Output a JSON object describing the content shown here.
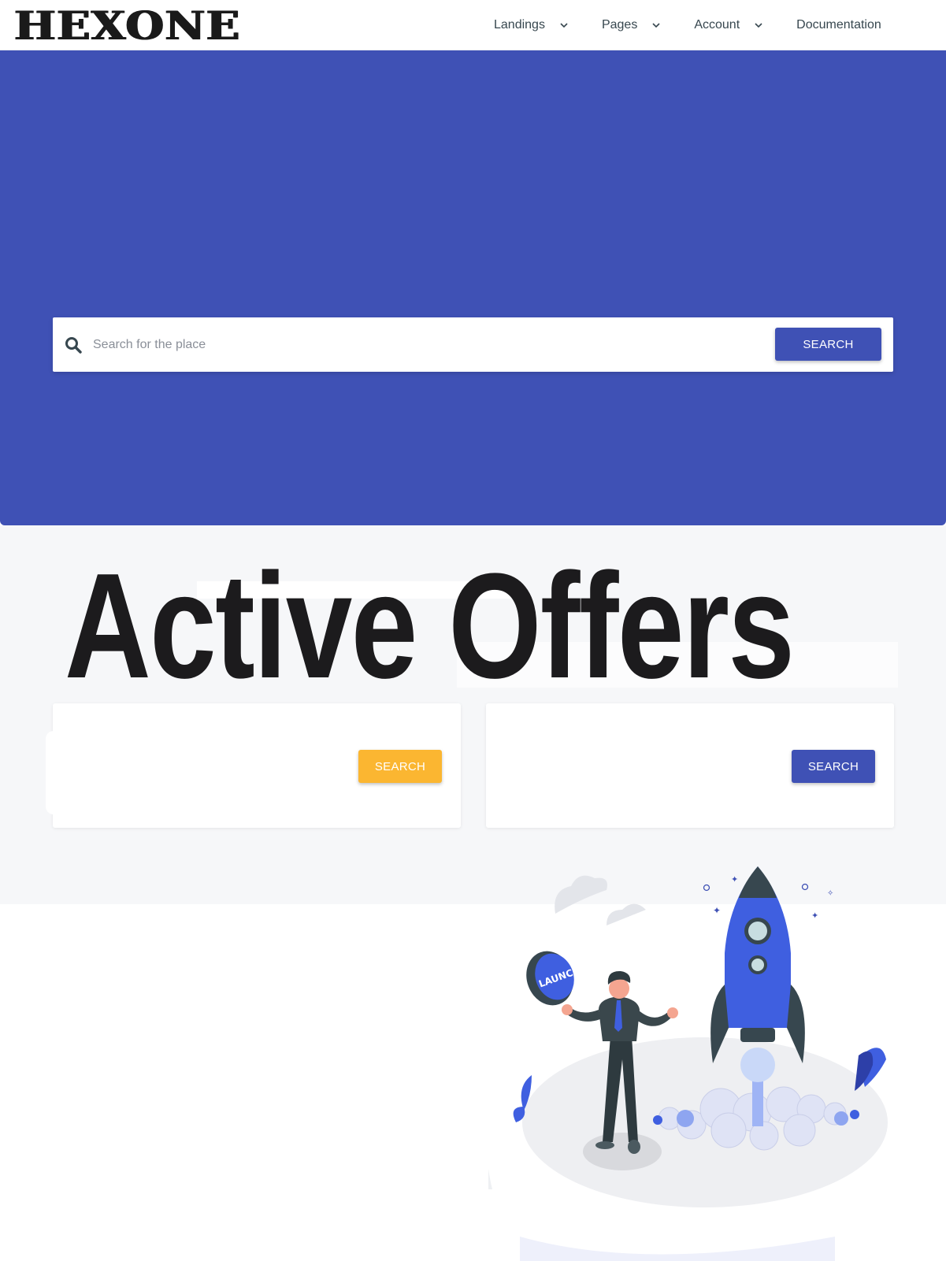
{
  "brand": {
    "logo_text": "HEXONE"
  },
  "nav": {
    "items": [
      {
        "label": "Landings",
        "has_dropdown": true
      },
      {
        "label": "Pages",
        "has_dropdown": true
      },
      {
        "label": "Account",
        "has_dropdown": true
      },
      {
        "label": "Documentation",
        "has_dropdown": false
      }
    ]
  },
  "hero": {
    "search_placeholder": "Search for the place",
    "search_button": "SEARCH"
  },
  "offers": {
    "title": "Active Offers",
    "cards": [
      {
        "button_label": "SEARCH"
      },
      {
        "button_label": "SEARCH"
      }
    ]
  },
  "illustration": {
    "button_text": "LAUNCH"
  },
  "colors": {
    "primary": "#3f51b5",
    "warning": "#fbb631",
    "text_dark": "#1c1b1d",
    "nav_text": "#37474f"
  }
}
